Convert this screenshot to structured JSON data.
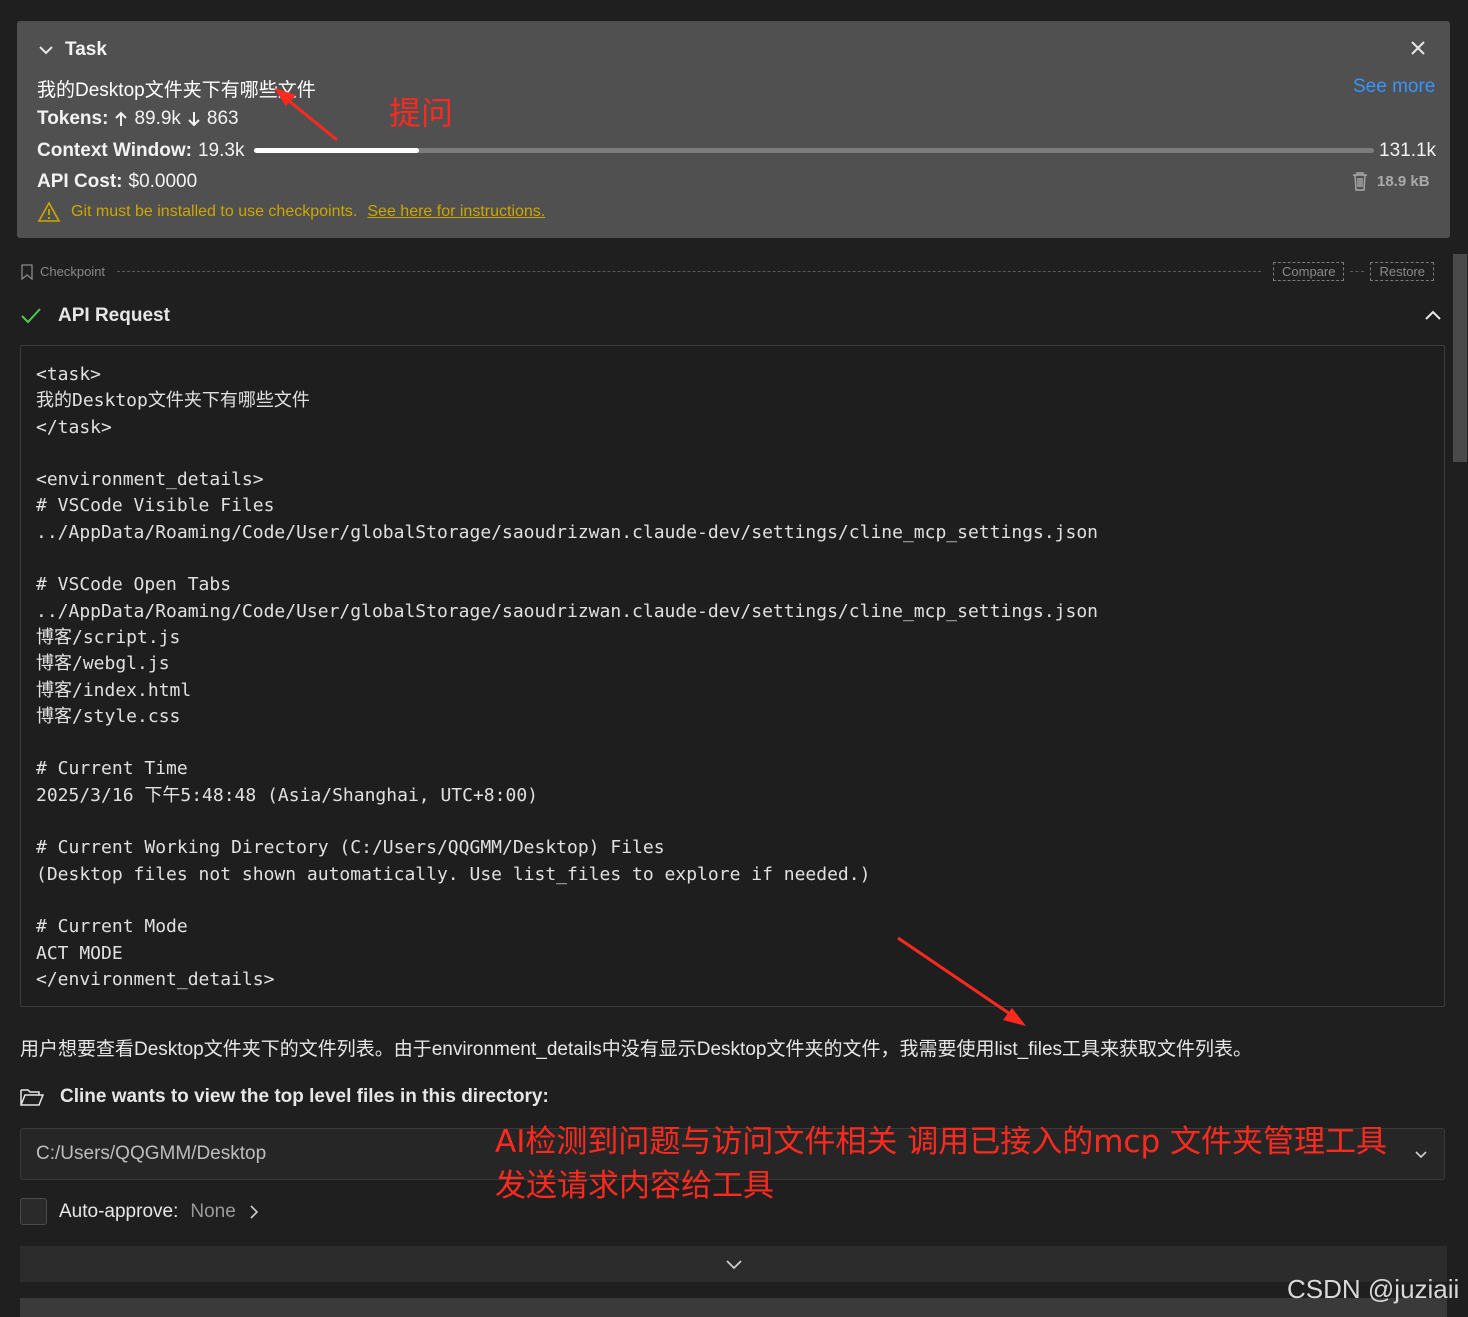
{
  "task": {
    "header_label": "Task",
    "text": "我的Desktop文件夹下有哪些文件",
    "see_more": "See more",
    "tokens_label": "Tokens:",
    "tokens_up": "89.9k",
    "tokens_down": "863",
    "context_label": "Context Window:",
    "context_used": "19.3k",
    "context_max": "131.1k",
    "context_fraction": 0.147,
    "cost_label": "API Cost:",
    "cost_value": "$0.0000",
    "size": "18.9 kB",
    "warning_text": "Git must be installed to use checkpoints.",
    "warning_link": "See here for instructions."
  },
  "checkpoint": {
    "label": "Checkpoint",
    "compare": "Compare",
    "restore": "Restore"
  },
  "api_request": {
    "title": "API Request",
    "content": "<task>\n我的Desktop文件夹下有哪些文件\n</task>\n\n<environment_details>\n# VSCode Visible Files\n../AppData/Roaming/Code/User/globalStorage/saoudrizwan.claude-dev/settings/cline_mcp_settings.json\n\n# VSCode Open Tabs\n../AppData/Roaming/Code/User/globalStorage/saoudrizwan.claude-dev/settings/cline_mcp_settings.json\n博客/script.js\n博客/webgl.js\n博客/index.html\n博客/style.css\n\n# Current Time\n2025/3/16 下午5:48:48 (Asia/Shanghai, UTC+8:00)\n\n# Current Working Directory (C:/Users/QQGMM/Desktop) Files\n(Desktop files not shown automatically. Use list_files to explore if needed.)\n\n# Current Mode\nACT MODE\n</environment_details>"
  },
  "assistant_text": "用户想要查看Desktop文件夹下的文件列表。由于environment_details中没有显示Desktop文件夹的文件，我需要使用list_files工具来获取文件列表。",
  "view_files": {
    "title": "Cline wants to view the top level files in this directory:",
    "path": "C:/Users/QQGMM/Desktop"
  },
  "auto_approve": {
    "label": "Auto-approve:",
    "value": "None"
  },
  "annotations": {
    "question": "提问",
    "ai_line1": "AI检测到问题与访问文件相关  调用已接入的mcp 文件夹管理工具",
    "ai_line2": "发送请求内容给工具"
  },
  "watermark": "CSDN @juziaii",
  "colors": {
    "link": "#3794ff",
    "warning": "#cca700",
    "success": "#4ec94e",
    "annotation": "#ff2a1f"
  }
}
